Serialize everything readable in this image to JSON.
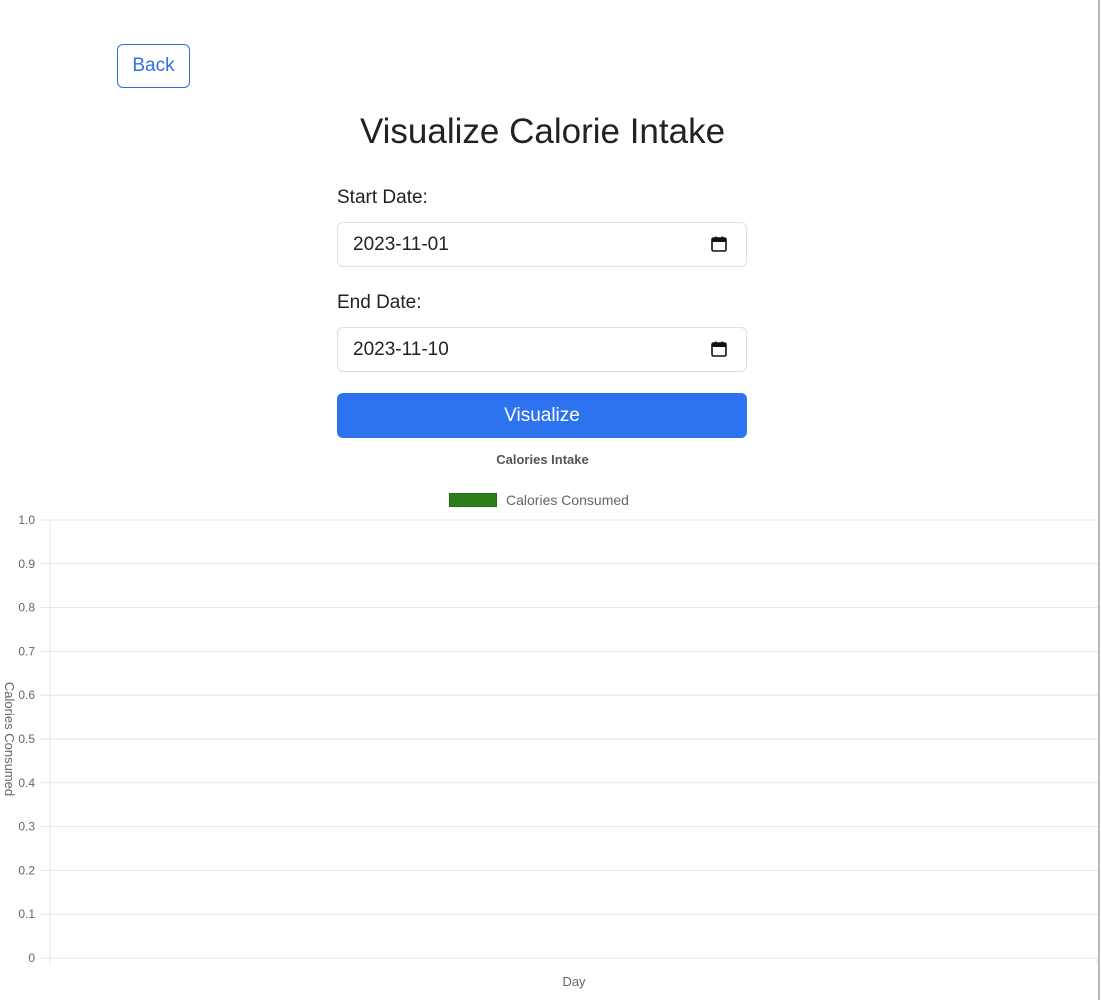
{
  "nav": {
    "back_label": "Back"
  },
  "page": {
    "title": "Visualize Calorie Intake"
  },
  "form": {
    "start_label": "Start Date:",
    "start_value": "2023-11-01",
    "end_label": "End Date:",
    "end_value": "2023-11-10",
    "submit_label": "Visualize"
  },
  "icons": {
    "calendar": "calendar-icon"
  },
  "colors": {
    "accent": "#2d73f0",
    "series": "#2e7d1c"
  },
  "chart_data": {
    "type": "bar",
    "title": "Calories Intake",
    "legend": "top",
    "xlabel": "Day",
    "ylabel": "Calories Consumed",
    "categories": [],
    "series": [
      {
        "name": "Calories Consumed",
        "values": []
      }
    ],
    "ylim": [
      0,
      1
    ],
    "yticks": [
      "0",
      "0.1",
      "0.2",
      "0.3",
      "0.4",
      "0.5",
      "0.6",
      "0.7",
      "0.8",
      "0.9",
      "1.0"
    ],
    "grid": true
  }
}
